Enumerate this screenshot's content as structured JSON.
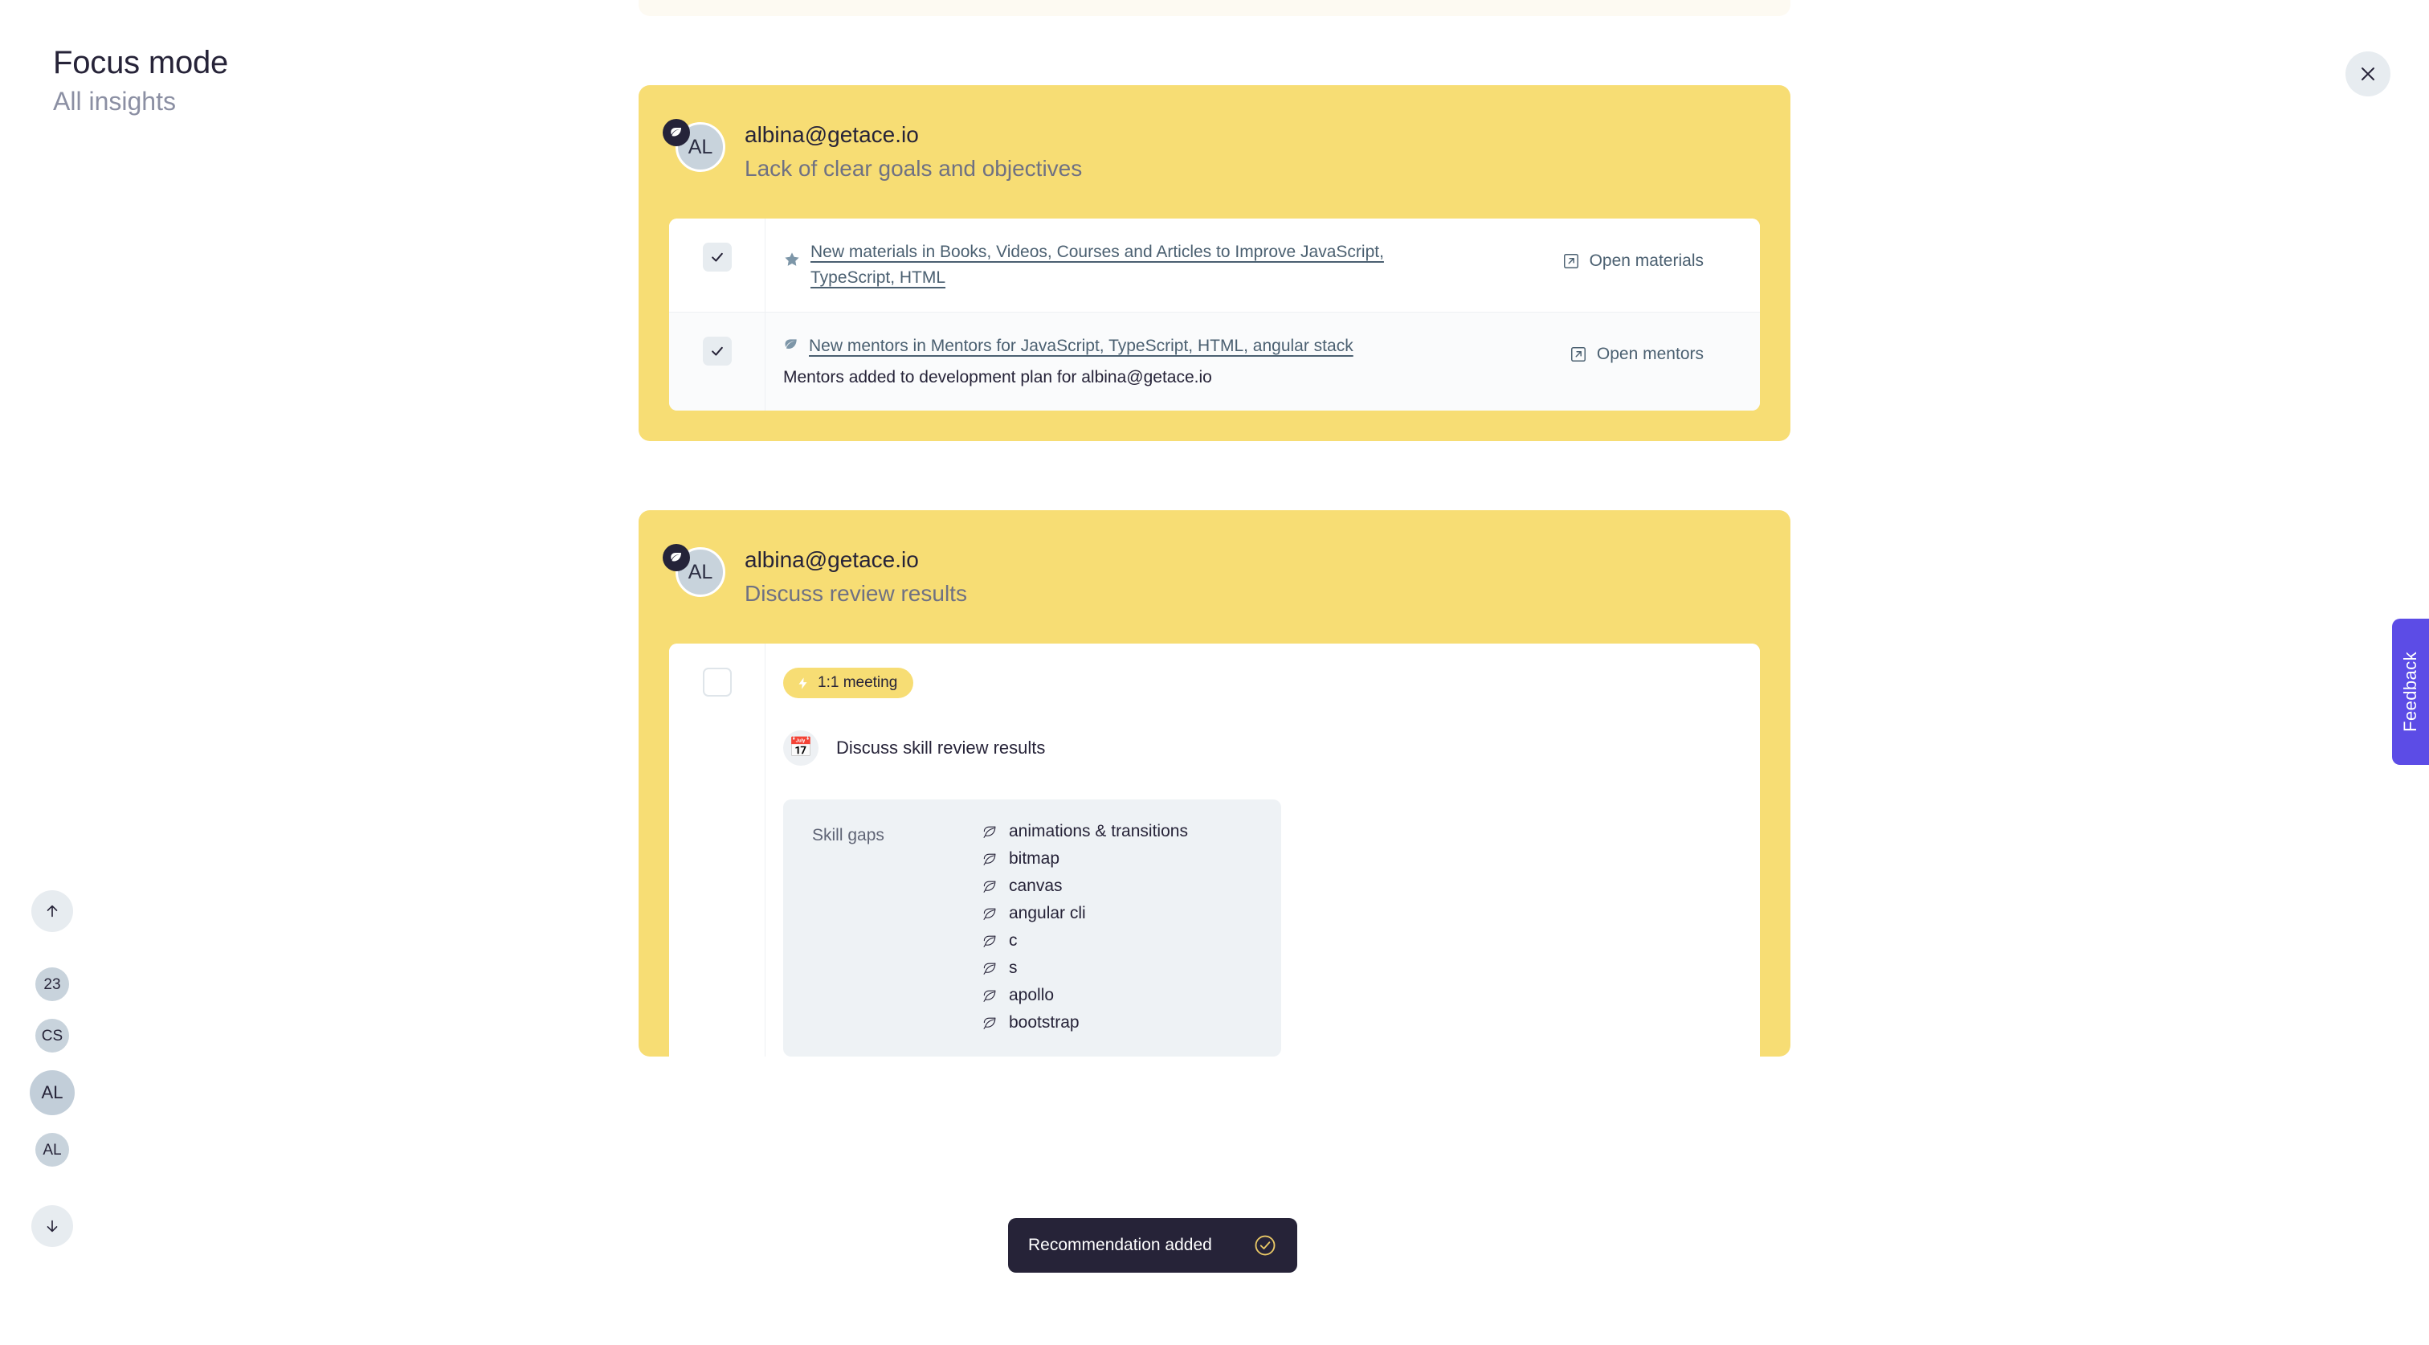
{
  "header": {
    "title": "Focus mode",
    "subtitle": "All insights"
  },
  "close_button": {
    "icon": "close-icon",
    "label": ""
  },
  "feedback_tab": {
    "label": "Feedback",
    "color": "#5c4ce6"
  },
  "left_rail": {
    "scroll_up": {
      "icon": "arrow-up-icon"
    },
    "scroll_down": {
      "icon": "arrow-down-icon"
    },
    "avatars": [
      {
        "initials": "23",
        "active": false
      },
      {
        "initials": "CS",
        "active": false
      },
      {
        "initials": "AL",
        "active": true
      },
      {
        "initials": "AL",
        "active": false
      }
    ]
  },
  "cards": [
    {
      "id": "card-goals",
      "email": "albina@getace.io",
      "subtitle": "Lack of clear goals and objectives",
      "avatar_initials": "AL",
      "badge_icon": "leaf-icon",
      "rows": [
        {
          "checked": true,
          "icon": "star-icon",
          "link_text": "New materials in Books, Videos, Courses and Articles to Improve JavaScript, TypeScript, HTML",
          "action_label": "Open materials",
          "action_icon": "external-link-icon",
          "sub_text": ""
        },
        {
          "checked": true,
          "icon": "leaf-icon",
          "link_text": "New mentors in Mentors for JavaScript, TypeScript, HTML, angular stack",
          "action_label": "Open mentors",
          "action_icon": "external-link-icon",
          "sub_text": "Mentors added to development plan for albina@getace.io"
        }
      ]
    },
    {
      "id": "card-review",
      "email": "albina@getace.io",
      "subtitle": "Discuss review results",
      "avatar_initials": "AL",
      "badge_icon": "leaf-icon",
      "meeting": {
        "checked": false,
        "badge_label": "1:1 meeting",
        "badge_icon": "lightning-icon",
        "title": "Discuss skill review results",
        "title_icon": "calendar-icon",
        "gaps_label": "Skill gaps",
        "gaps": [
          "animations & transitions",
          "bitmap",
          "canvas",
          "angular cli",
          "c",
          "s",
          "apollo",
          "bootstrap"
        ]
      }
    }
  ],
  "toast": {
    "message": "Recommendation added",
    "icon": "check-circle-icon"
  },
  "colors": {
    "card_yellow": "#f7dd74",
    "card_cream": "#fdfaf2",
    "toast_bg": "#262338",
    "accent_purple": "#5c4ce6",
    "panel_gray": "#eef2f5"
  }
}
